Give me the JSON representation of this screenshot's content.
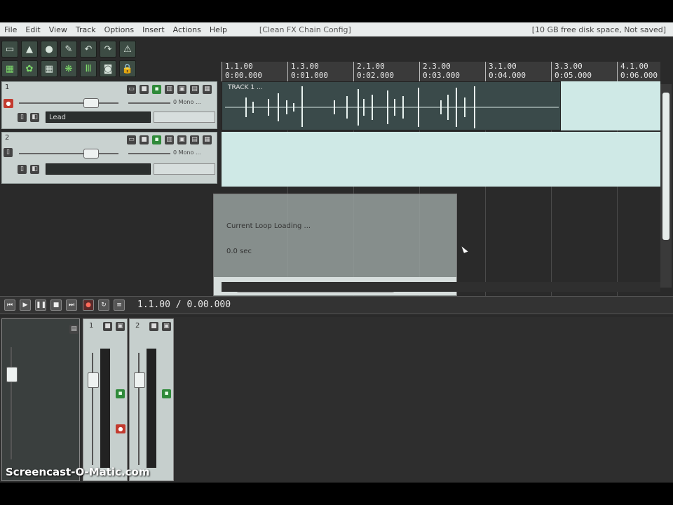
{
  "menu": {
    "items": [
      "File",
      "Edit",
      "View",
      "Track",
      "Options",
      "Insert",
      "Actions",
      "Help"
    ],
    "window_title": "[Clean FX Chain Config]",
    "status": "[10 GB free disk space, Not saved]"
  },
  "ruler": {
    "ticks": [
      {
        "bar": "1.1.00",
        "time": "0:00.000"
      },
      {
        "bar": "1.3.00",
        "time": "0:01.000"
      },
      {
        "bar": "2.1.00",
        "time": "0:02.000"
      },
      {
        "bar": "2.3.00",
        "time": "0:03.000"
      },
      {
        "bar": "3.1.00",
        "time": "0:04.000"
      },
      {
        "bar": "3.3.00",
        "time": "0:05.000"
      },
      {
        "bar": "4.1.00",
        "time": "0:06.000"
      }
    ]
  },
  "tracks": [
    {
      "number": "1",
      "name": "Lead",
      "fx_label": "0 Mono ...",
      "item_name": "TRACK 1 ..."
    },
    {
      "number": "2",
      "name": "",
      "fx_label": "0 Mono ...",
      "item_name": ""
    }
  ],
  "dialog": {
    "line1": "Current Loop Loading ...",
    "line2": "0.0 sec"
  },
  "transport": {
    "time": "1.1.00 / 0.00.000"
  },
  "mixer": {
    "strips": [
      {
        "number": "1"
      },
      {
        "number": "2"
      }
    ]
  },
  "watermark": "Screencast-O-Matic.com",
  "colors": {
    "track_bg": "#c9d2d0",
    "item_bg": "#3a4a4a",
    "record_red": "#c23a2e",
    "accent_green": "#2f8a3a"
  }
}
